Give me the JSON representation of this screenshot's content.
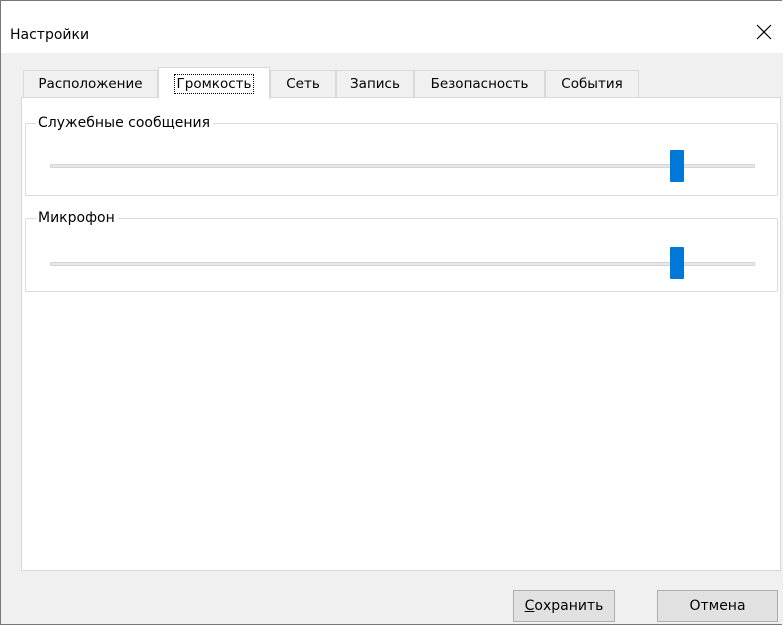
{
  "window": {
    "title": "Настройки"
  },
  "titlebar": {
    "close_icon": "close-icon"
  },
  "tabs": [
    {
      "label": "Расположение",
      "active": false
    },
    {
      "label": "Громкость",
      "active": true
    },
    {
      "label": "Сеть",
      "active": false
    },
    {
      "label": "Запись",
      "active": false
    },
    {
      "label": "Безопасность",
      "active": false
    },
    {
      "label": "События",
      "active": false
    }
  ],
  "groups": {
    "service_messages": {
      "caption": "Служебные сообщения",
      "slider_level": 0.89
    },
    "microphone": {
      "caption": "Микрофон",
      "slider_level": 0.89
    }
  },
  "buttons": {
    "save": {
      "mnemonic": "С",
      "rest": "охранить"
    },
    "cancel": {
      "label": "Отмена"
    }
  },
  "colors": {
    "slider_thumb": "#0078d7",
    "dialog_background": "#f0f0f0",
    "page_background": "#ffffff"
  }
}
